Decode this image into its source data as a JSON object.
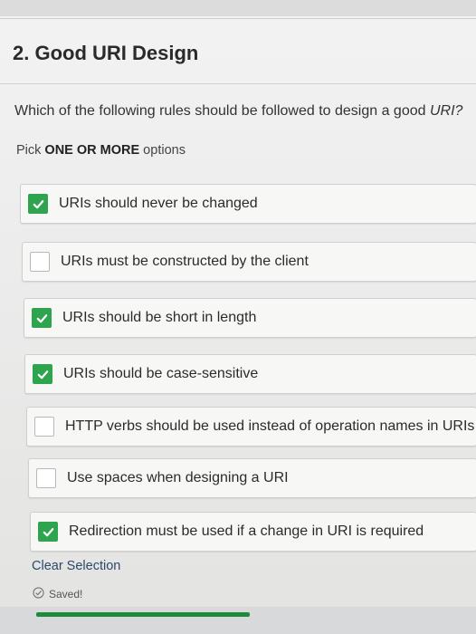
{
  "question": {
    "title": "2. Good URI Design",
    "text": "Which of the following rules should be followed to design a good ",
    "text_em": "URI?",
    "pick_prefix": "Pick ",
    "pick_bold": "ONE OR MORE",
    "pick_suffix": " options"
  },
  "options": [
    {
      "label": "URIs should never be changed",
      "checked": true
    },
    {
      "label": "URIs must be constructed by the client",
      "checked": false
    },
    {
      "label": "URIs should be short in length",
      "checked": true
    },
    {
      "label": "URIs should be case-sensitive",
      "checked": true
    },
    {
      "label": "HTTP verbs should be used instead of operation names in URIs",
      "checked": false
    },
    {
      "label": "Use spaces when designing a URI",
      "checked": false
    },
    {
      "label": "Redirection must be used if a change in URI is required",
      "checked": true
    }
  ],
  "footer": {
    "clear_label": "Clear Selection",
    "saved_label": "Saved!"
  },
  "colors": {
    "check_green": "#2ea44f",
    "link": "#2a4a6a"
  }
}
